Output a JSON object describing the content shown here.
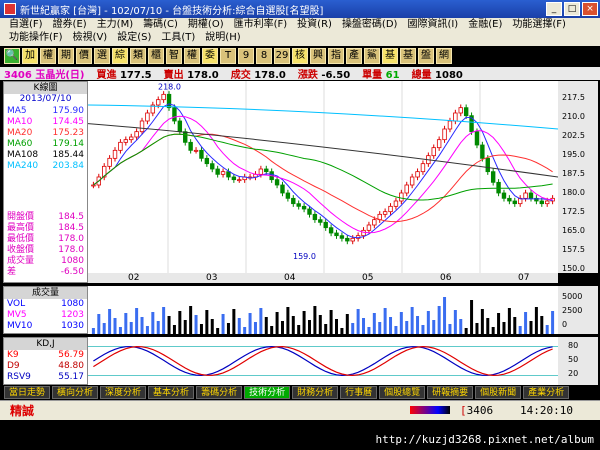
{
  "window": {
    "title": "新世紀贏家 [台灣] - 102/07/10 - 台盤技術分析:綜合自選股[名望股]"
  },
  "menu": [
    "自選(F)",
    "證券(E)",
    "主力(M)",
    "籌碼(C)",
    "期權(O)",
    "匯市利率(F)",
    "投資(R)",
    "操盤密碼(D)",
    "國際資訊(I)",
    "金融(E)",
    "功能選擇(F)",
    "功能操作(F)",
    "檢視(V)",
    "設定(S)",
    "工具(T)",
    "說明(H)"
  ],
  "toolbar": [
    "加",
    "權",
    "期",
    "價",
    "選",
    "綜",
    "類",
    "櫃",
    "智",
    "權",
    "委",
    "T",
    "9",
    "8",
    "29",
    "核",
    "興",
    "指",
    "產",
    "鯊",
    "基",
    "基",
    "盤",
    "網"
  ],
  "quote": {
    "symbol": "3406 玉晶光(日)",
    "bid_label": "買進",
    "bid": "177.5",
    "ask_label": "賣出",
    "ask": "178.0",
    "last_label": "成交",
    "last": "178.0",
    "chg_label": "漲跌",
    "chg": "-6.50",
    "vol_label": "單量",
    "vol": "61",
    "total_label": "總量",
    "total": "1080"
  },
  "leftpanel": {
    "header": "K線圖",
    "date": "2013/07/10",
    "ma": [
      {
        "name": "MA5",
        "value": "175.90",
        "color": "#2a2aff"
      },
      {
        "name": "MA10",
        "value": "174.45",
        "color": "#ff00ff"
      },
      {
        "name": "MA20",
        "value": "175.23",
        "color": "#ff3030"
      },
      {
        "name": "MA60",
        "value": "179.14",
        "color": "#00a000"
      },
      {
        "name": "MA108",
        "value": "185.44",
        "color": "#000000"
      },
      {
        "name": "MA240",
        "value": "203.84",
        "color": "#00c0ff"
      }
    ],
    "ohlc": [
      {
        "name": "開盤價",
        "value": "184.5"
      },
      {
        "name": "最高價",
        "value": "184.5"
      },
      {
        "name": "最低價",
        "value": "178.0"
      },
      {
        "name": "收盤價",
        "value": "178.0"
      },
      {
        "name": "成交量",
        "value": "1080"
      },
      {
        "name": "差",
        "value": "-6.50"
      }
    ],
    "hi_label": "218.0",
    "lo_label": "159.0"
  },
  "price_axis": [
    "217.5",
    "210.0",
    "202.5",
    "195.0",
    "187.5",
    "180.0",
    "172.5",
    "165.0",
    "157.5",
    "150.0"
  ],
  "x_axis": [
    "02",
    "03",
    "04",
    "05",
    "06",
    "07"
  ],
  "volpanel": {
    "header": "成交量",
    "rows": [
      {
        "name": "VOL",
        "value": "1080",
        "color": "#0000ff"
      },
      {
        "name": "MV5",
        "value": "1203",
        "color": "#ff00ff"
      },
      {
        "name": "MV10",
        "value": "1030",
        "color": "#0000ff"
      }
    ]
  },
  "vol_axis": [
    "5000",
    "2500",
    "0"
  ],
  "kdpanel": {
    "header": "KD,J",
    "rows": [
      {
        "name": "K9",
        "value": "56.79",
        "color": "#ff0000"
      },
      {
        "name": "D9",
        "value": "48.80",
        "color": "#c00000"
      },
      {
        "name": "RSV9",
        "value": "55.17",
        "color": "#0000c0"
      }
    ]
  },
  "kd_axis": [
    "80",
    "50",
    "20"
  ],
  "tabs": [
    "當日走勢",
    "橫向分析",
    "深度分析",
    "基本分析",
    "籌碼分析",
    "技術分析",
    "財務分析",
    "行事曆",
    "個股總覽",
    "研報摘要",
    "個股新聞",
    "產業分析"
  ],
  "status": {
    "label": "精誠",
    "code": "3406",
    "time": "14:20:10"
  },
  "watermark": "http://kuzjd3268.pixnet.net/album",
  "chart_data": {
    "type": "candlestick",
    "y_range": [
      150,
      222
    ],
    "high_mark": 218.0,
    "low_mark": 159.0,
    "closes": [
      183,
      186,
      190,
      193,
      196,
      199,
      200,
      201,
      203,
      207,
      210,
      213,
      215,
      217,
      212,
      207,
      203,
      199,
      196,
      196,
      193,
      191,
      189,
      187,
      188,
      186,
      185,
      185,
      186,
      186,
      187,
      189,
      188,
      185,
      183,
      180,
      178,
      176,
      175,
      174,
      172,
      170,
      169,
      167,
      165,
      164,
      163,
      162,
      163,
      164,
      166,
      168,
      170,
      172,
      173,
      175,
      177,
      180,
      183,
      186,
      188,
      191,
      194,
      197,
      200,
      204,
      207,
      210,
      212,
      209,
      203,
      198,
      193,
      188,
      184,
      180,
      178,
      177,
      176,
      178,
      180,
      178,
      177,
      176,
      177,
      178
    ]
  }
}
